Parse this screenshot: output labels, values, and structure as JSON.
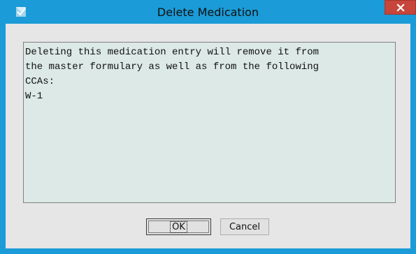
{
  "window": {
    "title": "Delete Medication",
    "app_icon": "checkmark-app-icon",
    "close_icon": "close-icon",
    "titlebar_color": "#1b9bd7",
    "close_color": "#c7453a"
  },
  "message": {
    "lines": [
      "Deleting this medication entry will remove it from",
      "the master formulary as well as from the following",
      "CCAs:",
      "W-1"
    ],
    "background_color": "#dce9e6"
  },
  "buttons": {
    "ok_label": "OK",
    "cancel_label": "Cancel"
  }
}
